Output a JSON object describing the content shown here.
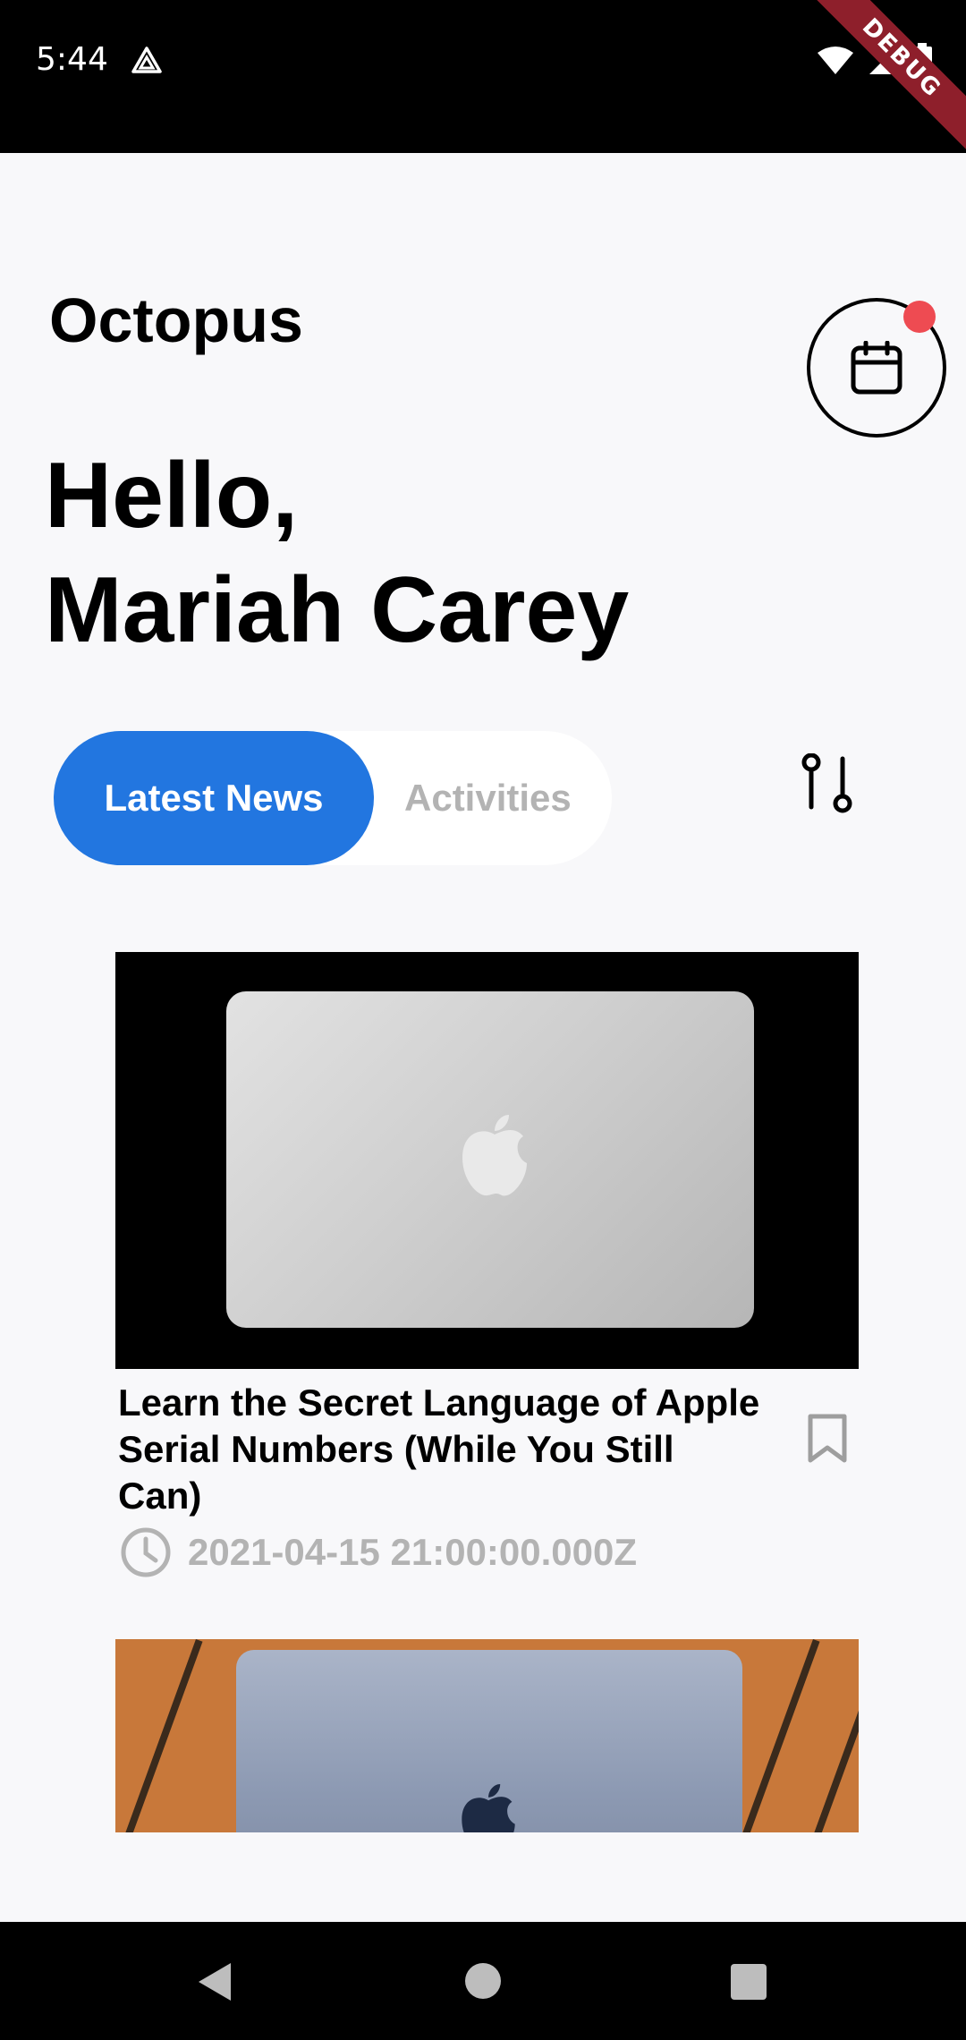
{
  "status_bar": {
    "time": "5:44",
    "app_icon": "triangle-app-icon",
    "wifi_icon": "wifi-icon",
    "signal_icon": "signal-icon",
    "battery_icon": "battery-icon",
    "debug_label": "DEBUG"
  },
  "header": {
    "app_title": "Octopus",
    "calendar_icon": "calendar-icon",
    "notification_color": "#ee4b52"
  },
  "greeting": {
    "line1": "Hello,",
    "line2": "Mariah Carey"
  },
  "tabs": {
    "active": "Latest News",
    "inactive": "Activities",
    "accent_color": "#2276e0",
    "filter_icon": "filter-sliders-icon"
  },
  "articles": [
    {
      "title": "Learn the Secret Language of Apple Serial Numbers (While You Still Can)",
      "date": "2021-04-15 21:00:00.000Z",
      "image": "silver-macbook-photo",
      "bookmark_icon": "bookmark-icon",
      "clock_icon": "clock-icon"
    },
    {
      "image": "blue-macbook-photo"
    }
  ],
  "nav_bar": {
    "back_icon": "back-triangle-icon",
    "home_icon": "home-circle-icon",
    "recents_icon": "recents-square-icon"
  }
}
